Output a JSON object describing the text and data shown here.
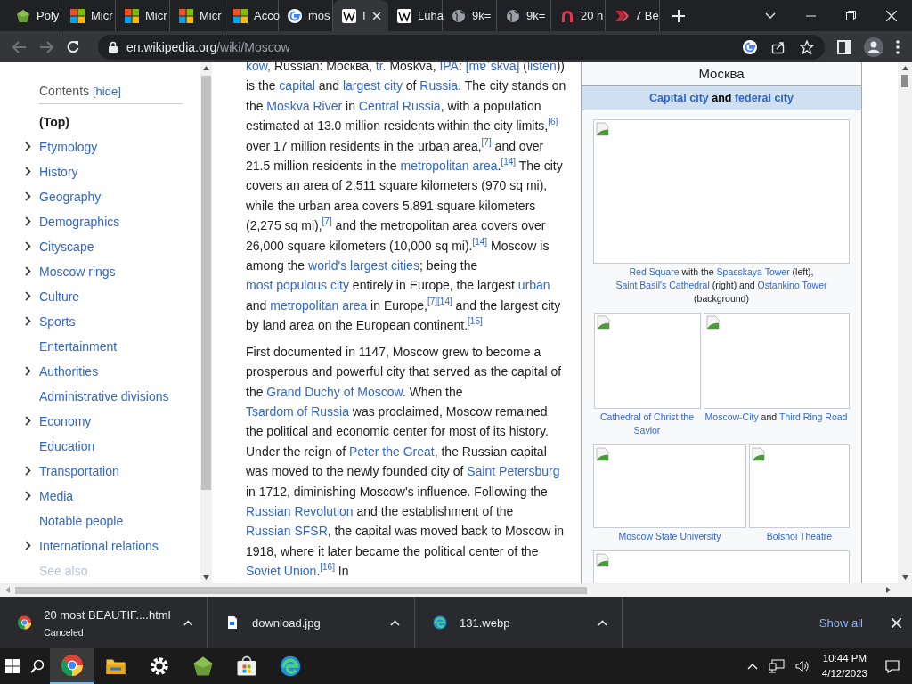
{
  "browser": {
    "tabs": [
      {
        "label": "Poly",
        "kind": "poly",
        "selected": false
      },
      {
        "label": "Micr",
        "kind": "ms",
        "selected": false
      },
      {
        "label": "Micr",
        "kind": "ms",
        "selected": false
      },
      {
        "label": "Micr",
        "kind": "ms",
        "selected": false
      },
      {
        "label": "Acco",
        "kind": "ms",
        "selected": false
      },
      {
        "label": "mos",
        "kind": "google",
        "selected": false
      },
      {
        "label": "I",
        "kind": "wiki",
        "selected": true
      },
      {
        "label": "Luha",
        "kind": "wiki",
        "selected": false
      },
      {
        "label": "9k=",
        "kind": "globe",
        "selected": false
      },
      {
        "label": "9k=",
        "kind": "globe",
        "selected": false
      },
      {
        "label": "20 n",
        "kind": "arch",
        "selected": false
      },
      {
        "label": "7 Be",
        "kind": "chevrons",
        "selected": false
      }
    ],
    "url": {
      "host": "en.wikipedia.org",
      "path": "/wiki/Moscow"
    }
  },
  "contents": {
    "title": "Contents",
    "toggle": "[hide]",
    "items": [
      {
        "label": "(Top)",
        "expandable": false,
        "selected": true
      },
      {
        "label": "Etymology",
        "expandable": true,
        "selected": false
      },
      {
        "label": "History",
        "expandable": true,
        "selected": false
      },
      {
        "label": "Geography",
        "expandable": true,
        "selected": false
      },
      {
        "label": "Demographics",
        "expandable": true,
        "selected": false
      },
      {
        "label": "Cityscape",
        "expandable": true,
        "selected": false
      },
      {
        "label": "Moscow rings",
        "expandable": true,
        "selected": false
      },
      {
        "label": "Culture",
        "expandable": true,
        "selected": false
      },
      {
        "label": "Sports",
        "expandable": true,
        "selected": false
      },
      {
        "label": "Entertainment",
        "expandable": false,
        "selected": false
      },
      {
        "label": "Authorities",
        "expandable": true,
        "selected": false
      },
      {
        "label": "Administrative divisions",
        "expandable": false,
        "selected": false
      },
      {
        "label": "Economy",
        "expandable": true,
        "selected": false
      },
      {
        "label": "Education",
        "expandable": false,
        "selected": false
      },
      {
        "label": "Transportation",
        "expandable": true,
        "selected": false
      },
      {
        "label": "Media",
        "expandable": true,
        "selected": false
      },
      {
        "label": "Notable people",
        "expandable": false,
        "selected": false
      },
      {
        "label": "International relations",
        "expandable": true,
        "selected": false
      },
      {
        "label": "See also",
        "expandable": false,
        "selected": false
      }
    ]
  },
  "article": {
    "paragraphs": [
      [
        {
          "kind": "link",
          "t": "kow,"
        },
        {
          "kind": "text",
          "t": "  Russian: Москва, "
        },
        {
          "kind": "link",
          "t": "tr."
        },
        {
          "kind": "text",
          "t": " Moskva, "
        },
        {
          "kind": "link",
          "t": "IPA"
        },
        {
          "kind": "text",
          "t": ": "
        },
        {
          "kind": "link",
          "t": "[mɐˈskva]"
        },
        {
          "kind": "text",
          "t": " ("
        },
        {
          "kind": "link",
          "t": "listen"
        },
        {
          "kind": "text",
          "t": ")) is the "
        },
        {
          "kind": "link",
          "t": "capital"
        },
        {
          "kind": "text",
          "t": " and "
        },
        {
          "kind": "link",
          "t": "largest city"
        },
        {
          "kind": "text",
          "t": " of "
        },
        {
          "kind": "link",
          "t": "Russia"
        },
        {
          "kind": "text",
          "t": ". The city stands on the "
        },
        {
          "kind": "link",
          "t": "Moskva River"
        },
        {
          "kind": "text",
          "t": " in "
        },
        {
          "kind": "link",
          "t": "Central Russia"
        },
        {
          "kind": "text",
          "t": ", with a population estimated at 13.0 million residents within the city limits,"
        },
        {
          "kind": "ref",
          "t": "[6]"
        },
        {
          "kind": "text",
          "t": " over 17 million residents in the urban area,"
        },
        {
          "kind": "ref",
          "t": "[7]"
        },
        {
          "kind": "text",
          "t": " and over 21.5 million residents in the "
        },
        {
          "kind": "link",
          "t": "metropolitan area"
        },
        {
          "kind": "text",
          "t": "."
        },
        {
          "kind": "ref",
          "t": "[14]"
        },
        {
          "kind": "text",
          "t": " The city covers an area of 2,511 square kilometers (970 sq mi), while the urban area covers 5,891 square kilometers (2,275 sq mi),"
        },
        {
          "kind": "ref",
          "t": "[7]"
        },
        {
          "kind": "text",
          "t": " and the metropolitan area covers over 26,000 square kilometers (10,000 sq mi)."
        },
        {
          "kind": "ref",
          "t": "[14]"
        },
        {
          "kind": "text",
          "t": " Moscow is among the "
        },
        {
          "kind": "link",
          "t": "world's largest cities"
        },
        {
          "kind": "text",
          "t": "; being the "
        },
        {
          "kind": "link",
          "t": "most populous city"
        },
        {
          "kind": "text",
          "t": " entirely in Europe, the largest "
        },
        {
          "kind": "link",
          "t": "urban"
        },
        {
          "kind": "text",
          "t": " and "
        },
        {
          "kind": "link",
          "t": "metropolitan area"
        },
        {
          "kind": "text",
          "t": " in Europe,"
        },
        {
          "kind": "ref",
          "t": "[7]"
        },
        {
          "kind": "ref",
          "t": "[14]"
        },
        {
          "kind": "text",
          "t": " and the largest city by land area on the European continent."
        },
        {
          "kind": "ref",
          "t": "[15]"
        }
      ],
      [
        {
          "kind": "text",
          "t": "First documented in 1147, Moscow grew to become a prosperous and powerful city that served as the capital of the "
        },
        {
          "kind": "link",
          "t": "Grand Duchy of Moscow"
        },
        {
          "kind": "text",
          "t": ". When the "
        },
        {
          "kind": "link",
          "t": "Tsardom of Russia"
        },
        {
          "kind": "text",
          "t": " was proclaimed, Moscow remained the political and economic center for most of its history. Under the reign of "
        },
        {
          "kind": "link",
          "t": "Peter the Great"
        },
        {
          "kind": "text",
          "t": ", the Russian capital was moved to the newly founded city of "
        },
        {
          "kind": "link",
          "t": "Saint Petersburg"
        },
        {
          "kind": "text",
          "t": " in 1712, diminishing Moscow's influence. Following the "
        },
        {
          "kind": "link",
          "t": "Russian Revolution"
        },
        {
          "kind": "text",
          "t": " and the establishment of the "
        },
        {
          "kind": "link",
          "t": "Russian SFSR"
        },
        {
          "kind": "text",
          "t": ", the capital was moved back to Moscow in 1918, where it later became the political center of the "
        },
        {
          "kind": "link",
          "t": "Soviet Union"
        },
        {
          "kind": "text",
          "t": "."
        },
        {
          "kind": "ref",
          "t": "[16]"
        },
        {
          "kind": "text",
          "t": " In"
        }
      ]
    ]
  },
  "infobox": {
    "title": "Москва",
    "subtitle": [
      {
        "kind": "link",
        "t": "Capital city"
      },
      {
        "kind": "text",
        "t": " and "
      },
      {
        "kind": "link",
        "t": "federal city"
      }
    ],
    "gallery": [
      [
        {
          "kind": "broken-image",
          "caption": [
            {
              "kind": "link",
              "t": "Red Square"
            },
            {
              "kind": "text",
              "t": " with the "
            },
            {
              "kind": "link",
              "t": "Spasskaya Tower"
            },
            {
              "kind": "text",
              "t": " (left), "
            },
            {
              "kind": "link",
              "t": "Saint Basil's Cathedral"
            },
            {
              "kind": "text",
              "t": " (right) and "
            },
            {
              "kind": "link",
              "t": "Ostankino Tower"
            },
            {
              "kind": "text",
              "t": " (background)"
            }
          ]
        }
      ],
      [
        {
          "kind": "broken-image",
          "caption": [
            {
              "kind": "link",
              "t": "Cathedral of Christ the Savior"
            }
          ]
        },
        {
          "kind": "broken-image",
          "caption": [
            {
              "kind": "link",
              "t": "Moscow-City"
            },
            {
              "kind": "text",
              "t": " and "
            },
            {
              "kind": "link",
              "t": "Third Ring Road"
            }
          ]
        }
      ],
      [
        {
          "kind": "broken-image",
          "caption": [
            {
              "kind": "link",
              "t": "Moscow State University"
            }
          ]
        },
        {
          "kind": "broken-image",
          "caption": [
            {
              "kind": "link",
              "t": "Bolshoi Theatre"
            }
          ]
        }
      ],
      [
        {
          "kind": "broken-image"
        }
      ]
    ]
  },
  "downloads": {
    "items": [
      {
        "name": "20 most BEAUTIF....html",
        "status": "Canceled",
        "kind": "chrome"
      },
      {
        "name": "download.jpg",
        "kind": "file"
      },
      {
        "name": "131.webp",
        "kind": "edge"
      }
    ],
    "show_all": "Show all"
  },
  "taskbar": {
    "apps": [
      {
        "kind": "chrome",
        "selected": true
      },
      {
        "kind": "folder",
        "selected": false
      },
      {
        "kind": "gear",
        "selected": false
      },
      {
        "kind": "poly",
        "selected": false
      },
      {
        "kind": "store",
        "selected": false
      },
      {
        "kind": "edge",
        "selected": false
      }
    ],
    "time": "10:44 PM",
    "date": "4/12/2023"
  }
}
